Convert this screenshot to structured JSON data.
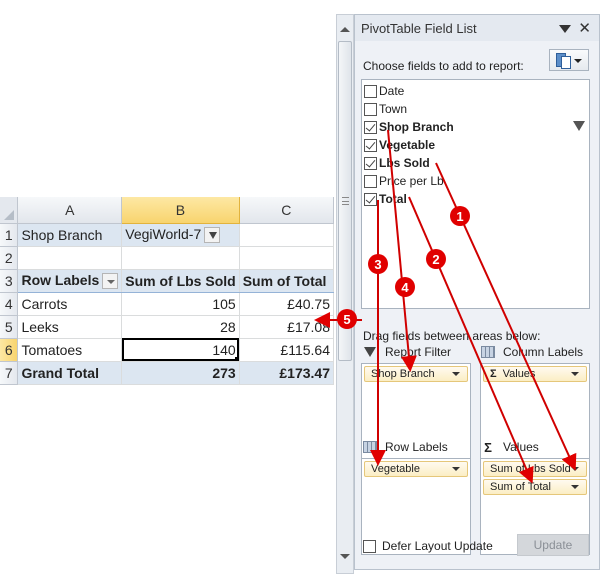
{
  "worksheet": {
    "columns": [
      "A",
      "B",
      "C"
    ],
    "selected_column": "B",
    "rows": [
      {
        "num": "1",
        "a": "Shop Branch",
        "b": "VegiWorld-7",
        "c": ""
      },
      {
        "num": "2",
        "a": "",
        "b": "",
        "c": ""
      },
      {
        "num": "3",
        "a": "Row Labels",
        "b": "Sum of Lbs Sold",
        "c": "Sum of Total"
      },
      {
        "num": "4",
        "a": "Carrots",
        "b": "105",
        "c": "£40.75"
      },
      {
        "num": "5",
        "a": "Leeks",
        "b": "28",
        "c": "£17.08"
      },
      {
        "num": "6",
        "a": "Tomatoes",
        "b": "140",
        "c": "£115.64"
      },
      {
        "num": "7",
        "a": "Grand Total",
        "b": "273",
        "c": "£173.47"
      }
    ],
    "selected_cell": "B6"
  },
  "pane": {
    "title": "PivotTable Field List",
    "choose_label": "Choose fields to add to report:",
    "fields": [
      {
        "label": "Date",
        "checked": false,
        "bold": false
      },
      {
        "label": "Town",
        "checked": false,
        "bold": false
      },
      {
        "label": "Shop Branch",
        "checked": true,
        "bold": true,
        "filtered": true
      },
      {
        "label": "Vegetable",
        "checked": true,
        "bold": true
      },
      {
        "label": "Lbs Sold",
        "checked": true,
        "bold": true
      },
      {
        "label": "Price per Lb",
        "checked": false,
        "bold": false
      },
      {
        "label": "Total",
        "checked": true,
        "bold": true
      }
    ],
    "drag_label": "Drag fields between areas below:",
    "areas": {
      "report_filter": {
        "label": "Report Filter",
        "items": [
          "Shop Branch"
        ]
      },
      "column_labels": {
        "label": "Column Labels",
        "items": [
          "Values"
        ]
      },
      "row_labels": {
        "label": "Row Labels",
        "items": [
          "Vegetable"
        ]
      },
      "values": {
        "label": "Values",
        "items": [
          "Sum of Lbs Sold",
          "Sum of Total"
        ]
      }
    },
    "defer_label": "Defer Layout Update",
    "defer_checked": false,
    "update_label": "Update",
    "sigma": "Σ"
  },
  "annotations": {
    "badges": [
      "1",
      "2",
      "3",
      "4",
      "5"
    ],
    "color": "#e00000"
  }
}
